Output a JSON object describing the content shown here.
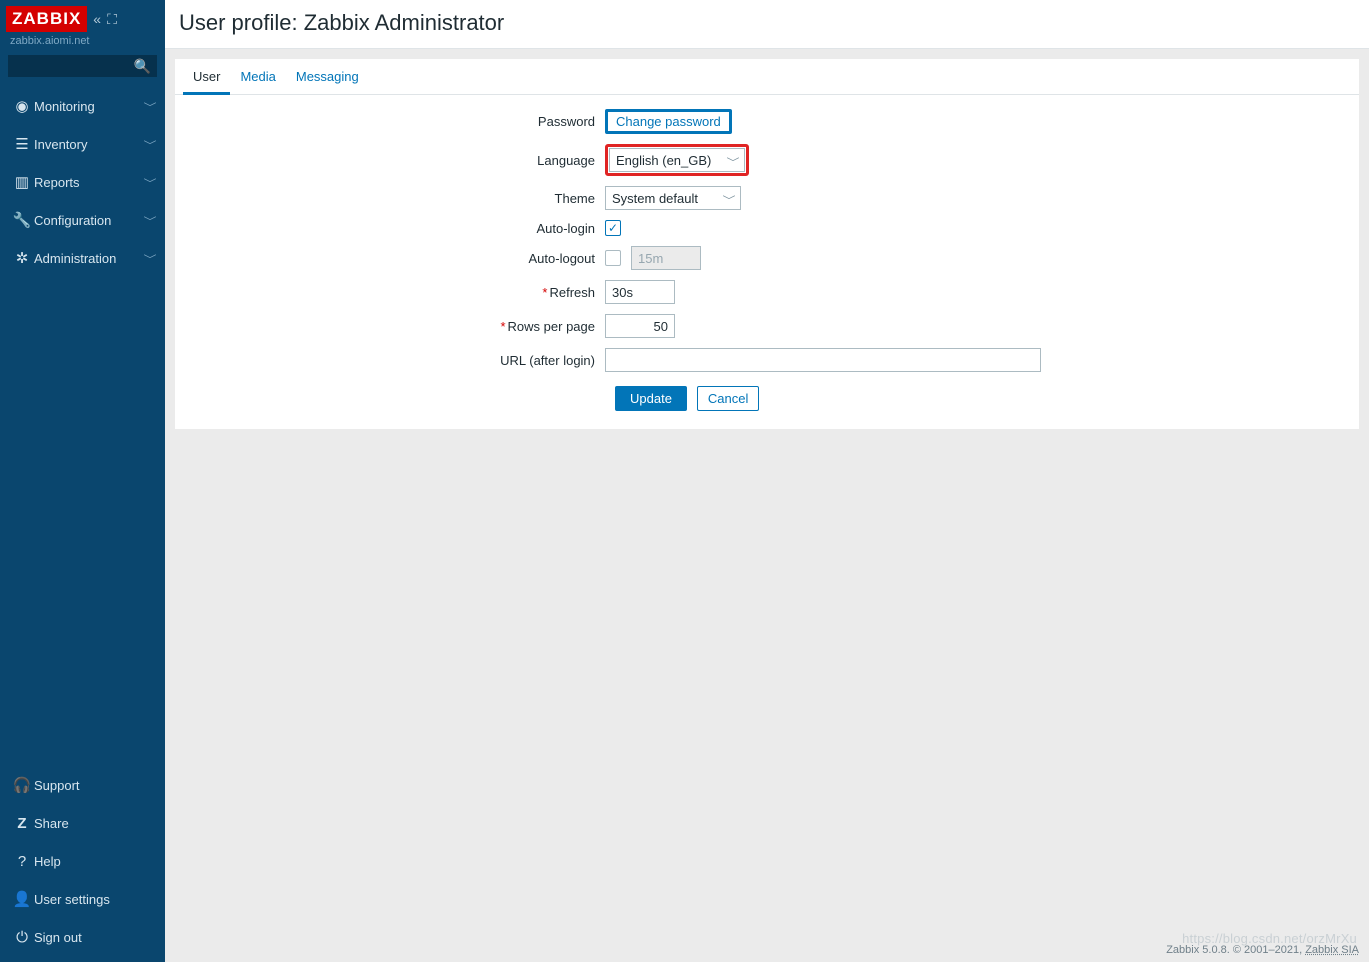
{
  "brand": {
    "logo_text": "ZABBIX",
    "host": "zabbix.aiomi.net"
  },
  "sidebar": {
    "nav": [
      {
        "icon": "eye-icon",
        "glyph": "◉",
        "label": "Monitoring"
      },
      {
        "icon": "list-icon",
        "glyph": "☰",
        "label": "Inventory"
      },
      {
        "icon": "chart-icon",
        "glyph": "▥",
        "label": "Reports"
      },
      {
        "icon": "wrench-icon",
        "glyph": "🔧",
        "label": "Configuration"
      },
      {
        "icon": "gear-icon",
        "glyph": "✲",
        "label": "Administration"
      }
    ],
    "bottom": [
      {
        "icon": "headset-icon",
        "glyph": "🎧",
        "label": "Support"
      },
      {
        "icon": "share-icon",
        "glyph": "Z",
        "label": "Share"
      },
      {
        "icon": "help-icon",
        "glyph": "?",
        "label": "Help"
      },
      {
        "icon": "user-icon",
        "glyph": "👤",
        "label": "User settings"
      },
      {
        "icon": "power-icon",
        "glyph": "⏻",
        "label": "Sign out"
      }
    ]
  },
  "page": {
    "title": "User profile: Zabbix Administrator"
  },
  "tabs": [
    {
      "label": "User",
      "active": true
    },
    {
      "label": "Media",
      "active": false
    },
    {
      "label": "Messaging",
      "active": false
    }
  ],
  "form": {
    "password": {
      "label": "Password",
      "button": "Change password"
    },
    "language": {
      "label": "Language",
      "value": "English (en_GB)"
    },
    "theme": {
      "label": "Theme",
      "value": "System default"
    },
    "auto_login": {
      "label": "Auto-login",
      "checked": true
    },
    "auto_logout": {
      "label": "Auto-logout",
      "checked": false,
      "value": "15m"
    },
    "refresh": {
      "label": "Refresh",
      "value": "30s",
      "required": true
    },
    "rows": {
      "label": "Rows per page",
      "value": "50",
      "required": true
    },
    "url": {
      "label": "URL (after login)",
      "value": ""
    },
    "actions": {
      "update": "Update",
      "cancel": "Cancel"
    }
  },
  "footer": {
    "text": "Zabbix 5.0.8. © 2001–2021, ",
    "link": "Zabbix SIA"
  },
  "watermark": "https://blog.csdn.net/orzMrXu"
}
